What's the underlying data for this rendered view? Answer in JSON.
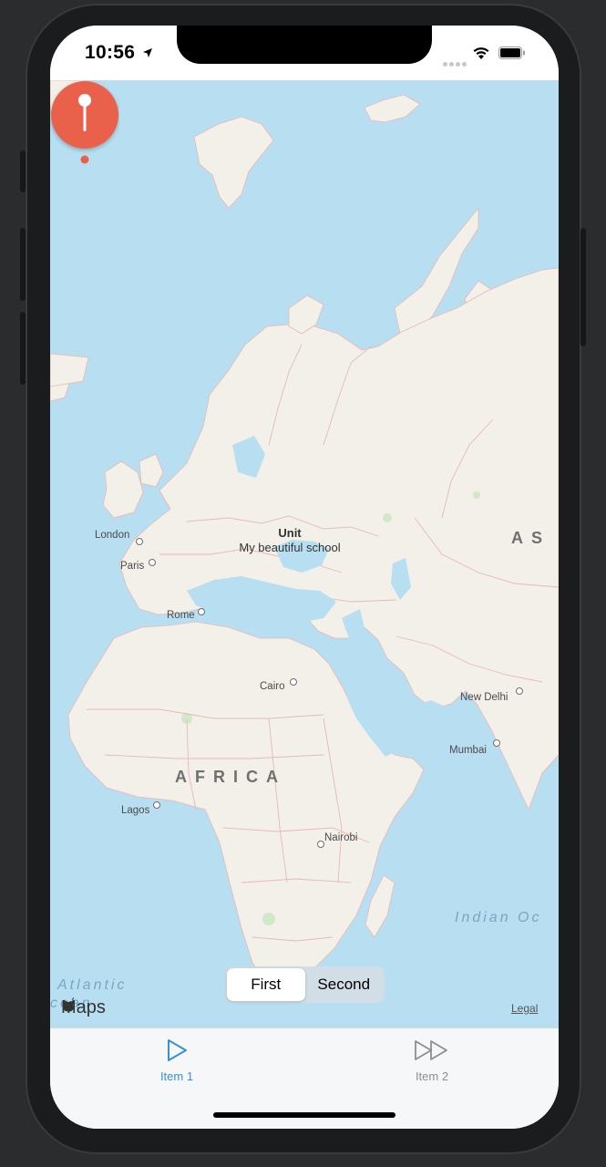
{
  "status_bar": {
    "time": "10:56",
    "icons": [
      "location-arrow-icon",
      "signal-icon",
      "wifi-icon",
      "battery-icon"
    ]
  },
  "map": {
    "annotation": {
      "title": "Unit",
      "subtitle": "My beautiful school",
      "pin_color": "#e9604c"
    },
    "cities": [
      {
        "name": "London"
      },
      {
        "name": "Paris"
      },
      {
        "name": "Rome"
      },
      {
        "name": "Cairo"
      },
      {
        "name": "New Delhi"
      },
      {
        "name": "Mumbai"
      },
      {
        "name": "Lagos"
      },
      {
        "name": "Nairobi"
      }
    ],
    "regions": [
      {
        "name": "AFRICA"
      },
      {
        "name": "AS"
      }
    ],
    "oceans": [
      {
        "name": "Atlantic"
      },
      {
        "name": "cean"
      },
      {
        "name": "Indian Oc"
      }
    ],
    "attribution": "Maps",
    "legal": "Legal"
  },
  "segmented_control": {
    "options": [
      "First",
      "Second"
    ],
    "selected": "First"
  },
  "tab_bar": {
    "items": [
      {
        "label": "Item 1",
        "icon": "play-icon",
        "active": true
      },
      {
        "label": "Item 2",
        "icon": "fast-forward-icon",
        "active": false
      }
    ],
    "active_color": "#3a8fd9",
    "inactive_color": "#8e8e93"
  }
}
